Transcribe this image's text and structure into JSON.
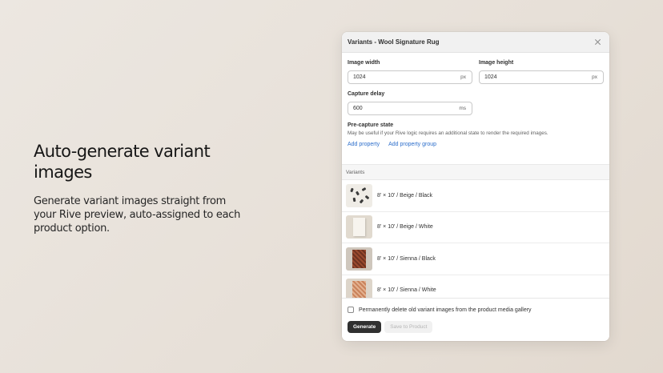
{
  "hero": {
    "title": "Auto-generate variant images",
    "description": "Generate variant images straight from your Rive preview, auto-assigned to each product option."
  },
  "modal": {
    "title": "Variants - Wool Signature Rug",
    "close_icon": "close-icon",
    "image_width": {
      "label": "Image width",
      "value": "1024",
      "unit": "px"
    },
    "image_height": {
      "label": "Image height",
      "value": "1024",
      "unit": "px"
    },
    "capture_delay": {
      "label": "Capture delay",
      "value": "600",
      "unit": "ms"
    },
    "pre_capture": {
      "label": "Pre-capture state",
      "help": "May be useful if your Rive logic requires an additional state to render the required images.",
      "add_property": "Add property",
      "add_property_group": "Add property group"
    },
    "variants_header": "Variants",
    "variants": [
      {
        "label": "8' × 10' / Beige / Black"
      },
      {
        "label": "8' × 10' / Beige / White"
      },
      {
        "label": "8' × 10' / Sienna / Black"
      },
      {
        "label": "8' × 10' / Sienna / White"
      }
    ],
    "footer": {
      "delete_label": "Permanently delete old variant images from the product media gallery",
      "delete_checked": false,
      "generate_button": "Generate",
      "save_button": "Save to Product"
    }
  },
  "colors": {
    "primary_button": "#303030",
    "link": "#2c6ecb",
    "background": "#e7e0d8"
  }
}
